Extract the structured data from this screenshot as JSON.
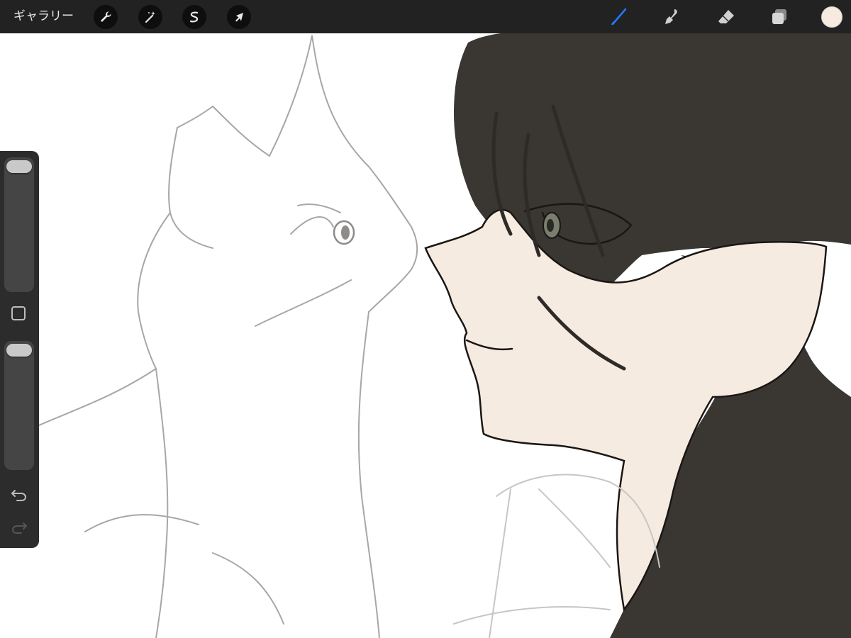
{
  "app": {
    "gallery_label": "ギャラリー"
  },
  "toolbar": {
    "left_tools": [
      "actions",
      "adjustments",
      "selection",
      "transform"
    ],
    "right_tools": [
      "brush",
      "smudge",
      "eraser",
      "layers"
    ],
    "active_tool": "brush",
    "current_color": "#f5ebe0"
  },
  "sidebar": {
    "brush_size_level": 0.05,
    "opacity_level": 0.02,
    "controls": [
      "brush-size-slider",
      "modify-button",
      "opacity-slider",
      "undo",
      "redo"
    ]
  },
  "colors": {
    "toolbar_bg": "#222222",
    "accent_blue": "#1f7bff",
    "skin": "#f5ebe0",
    "hair": "#3a3632",
    "sketch_line": "#a9a6a4"
  }
}
